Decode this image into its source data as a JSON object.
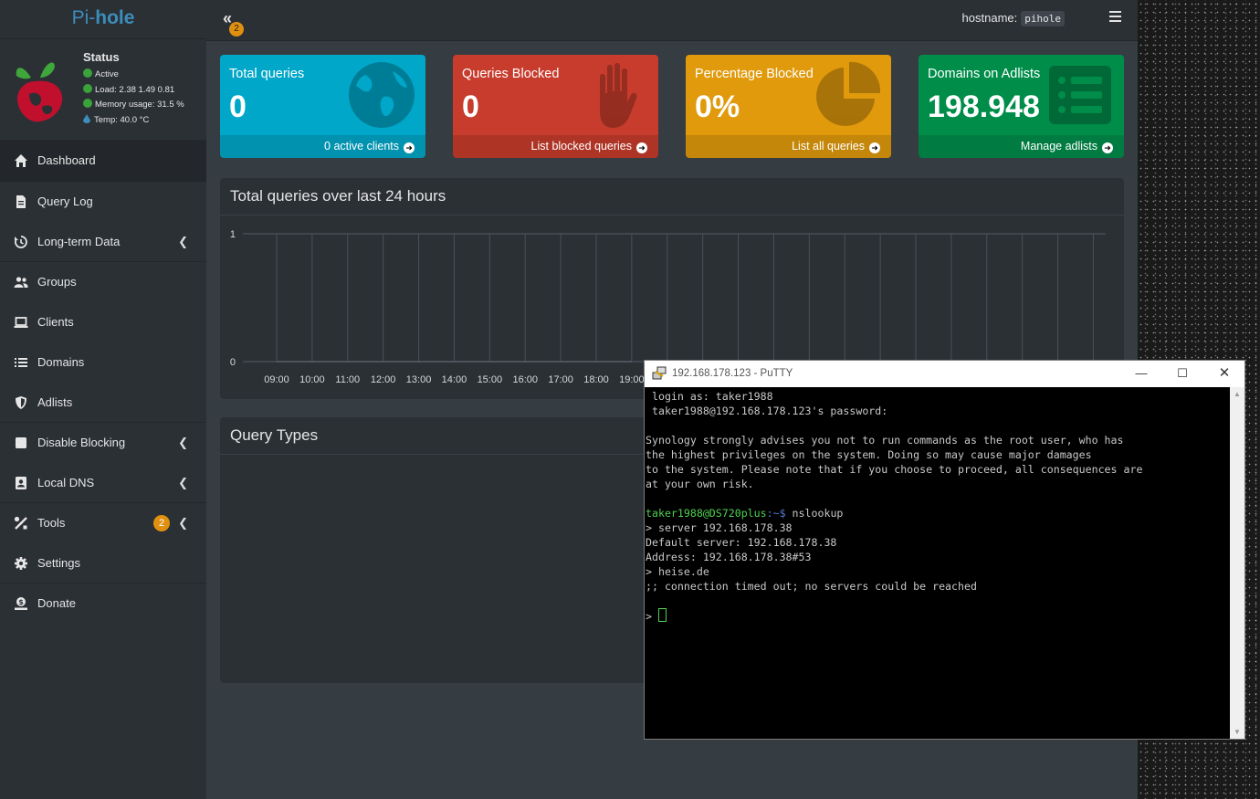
{
  "app": {
    "brand_light": "Pi-",
    "brand_bold": "hole",
    "status": {
      "title": "Status",
      "active": "Active",
      "load": "Load:  2.38  1.49  0.81",
      "memory": "Memory usage:  31.5 %",
      "temp": "Temp: 40.0 °C"
    },
    "nav": [
      {
        "label": "Dashboard",
        "icon": "home-icon"
      },
      {
        "label": "Query Log",
        "icon": "file-icon"
      },
      {
        "label": "Long-term Data",
        "icon": "history-icon"
      },
      {
        "label": "Groups",
        "icon": "users-icon"
      },
      {
        "label": "Clients",
        "icon": "laptop-icon"
      },
      {
        "label": "Domains",
        "icon": "list-icon"
      },
      {
        "label": "Adlists",
        "icon": "shield-icon"
      },
      {
        "label": "Disable Blocking",
        "icon": "stop-icon"
      },
      {
        "label": "Local DNS",
        "icon": "address-book-icon"
      },
      {
        "label": "Tools",
        "icon": "tools-icon",
        "badge": "2"
      },
      {
        "label": "Settings",
        "icon": "gear-icon"
      },
      {
        "label": "Donate",
        "icon": "donate-icon"
      }
    ],
    "topbar": {
      "toggle_badge": "2",
      "hostname_label": "hostname:",
      "hostname_value": "pihole"
    },
    "boxes": [
      {
        "label": "Total queries",
        "value": "0",
        "footer": "0 active clients",
        "color": "#00a7c8"
      },
      {
        "label": "Queries Blocked",
        "value": "0",
        "footer": "List blocked queries",
        "color": "#c73c2c"
      },
      {
        "label": "Percentage Blocked",
        "value": "0%",
        "footer": "List all queries",
        "color": "#e09a0c"
      },
      {
        "label": "Domains on Adlists",
        "value": "198.948",
        "footer": "Manage adlists",
        "color": "#008d4a"
      }
    ],
    "chart_title": "Total queries over last 24 hours",
    "query_types_title": "Query Types"
  },
  "chart_data": {
    "type": "line",
    "title": "Total queries over last 24 hours",
    "x": [
      "09:00",
      "10:00",
      "11:00",
      "12:00",
      "13:00",
      "14:00",
      "15:00",
      "16:00",
      "17:00",
      "18:00",
      "19:00"
    ],
    "series": [
      {
        "values": [
          0,
          0,
          0,
          0,
          0,
          0,
          0,
          0,
          0,
          0,
          0
        ]
      }
    ],
    "ylim": [
      0,
      1
    ],
    "yticks": [
      "1",
      "0"
    ],
    "grid": true
  },
  "putty": {
    "title": "192.168.178.123 - PuTTY",
    "lines": [
      " login as: taker1988",
      " taker1988@192.168.178.123's password:",
      "",
      "Synology strongly advises you not to run commands as the root user, who has",
      "the highest privileges on the system. Doing so may cause major damages",
      "to the system. Please note that if you choose to proceed, all consequences are",
      "at your own risk.",
      ""
    ],
    "prompt_user": "taker1988@DS720plus",
    "prompt_path": ":~$",
    "prompt_cmd": " nslookup",
    "output": [
      "> server 192.168.178.38",
      "Default server: 192.168.178.38",
      "Address: 192.168.178.38#53",
      "> heise.de",
      ";; connection timed out; no servers could be reached",
      ""
    ],
    "last_prompt": "> "
  }
}
